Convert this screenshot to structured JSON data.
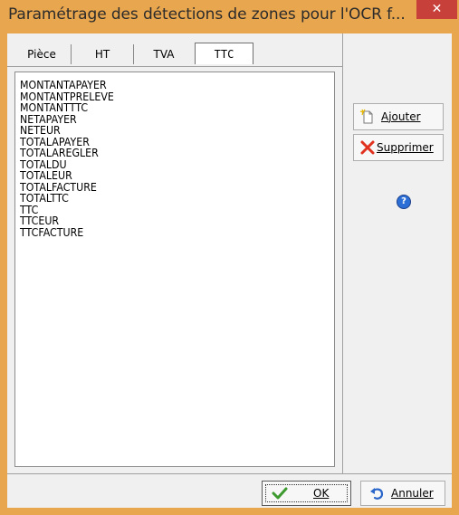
{
  "window": {
    "title": "Paramétrage des détections de zones pour l'OCR f...",
    "close_glyph": "✕",
    "title_bar_color": "#e8a64e"
  },
  "tabs": [
    {
      "label": "Pièce"
    },
    {
      "label": "HT"
    },
    {
      "label": "TVA"
    },
    {
      "label": "TTC",
      "active": true
    }
  ],
  "list": {
    "items": [
      "MONTANTAPAYER",
      "MONTANTPRELEVE",
      "MONTANTTTC",
      "NETAPAYER",
      "NETEUR",
      "TOTALAPAYER",
      "TOTALAREGLER",
      "TOTALDU",
      "TOTALEUR",
      "TOTALFACTURE",
      "TOTALTTC",
      "TTC",
      "TTCEUR",
      "TTCFACTURE"
    ]
  },
  "side_buttons": {
    "add_label": "Ajouter",
    "add_icon": "new-document-icon",
    "delete_label": "Supprimer",
    "delete_icon": "red-x-icon",
    "help_glyph": "?",
    "help_icon": "help-icon"
  },
  "bottom_buttons": {
    "ok_label": "OK",
    "ok_icon": "green-check-icon",
    "cancel_label": "Annuler",
    "cancel_icon": "undo-arrow-icon"
  }
}
